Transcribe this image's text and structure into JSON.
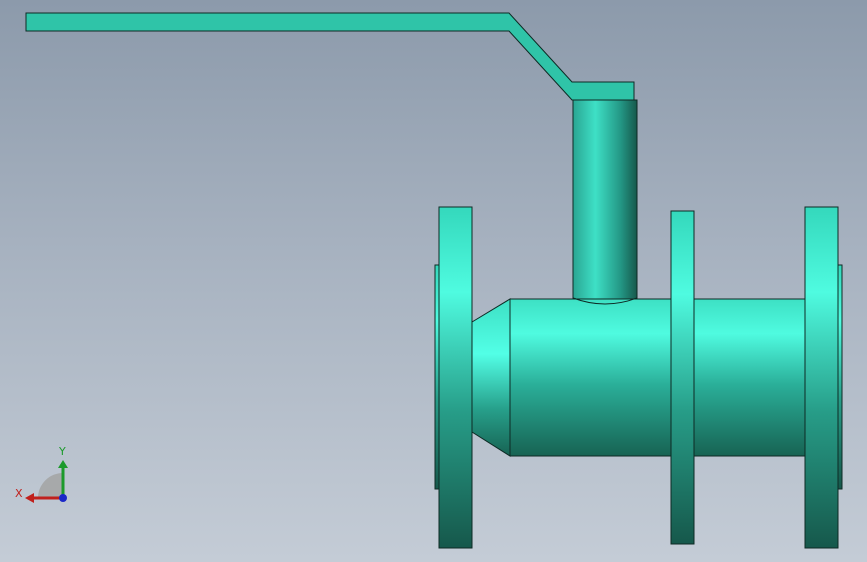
{
  "viewport": {
    "background_top": "#8c9aab",
    "background_bottom": "#c4ccd6",
    "model": {
      "part": "ball-valve",
      "color": "#2fc4a8"
    },
    "triad": {
      "x_label": "X",
      "y_label": "Y",
      "x_color": "#c0201c",
      "y_color": "#1c9a2c",
      "z_color": "#1a28c8"
    }
  }
}
